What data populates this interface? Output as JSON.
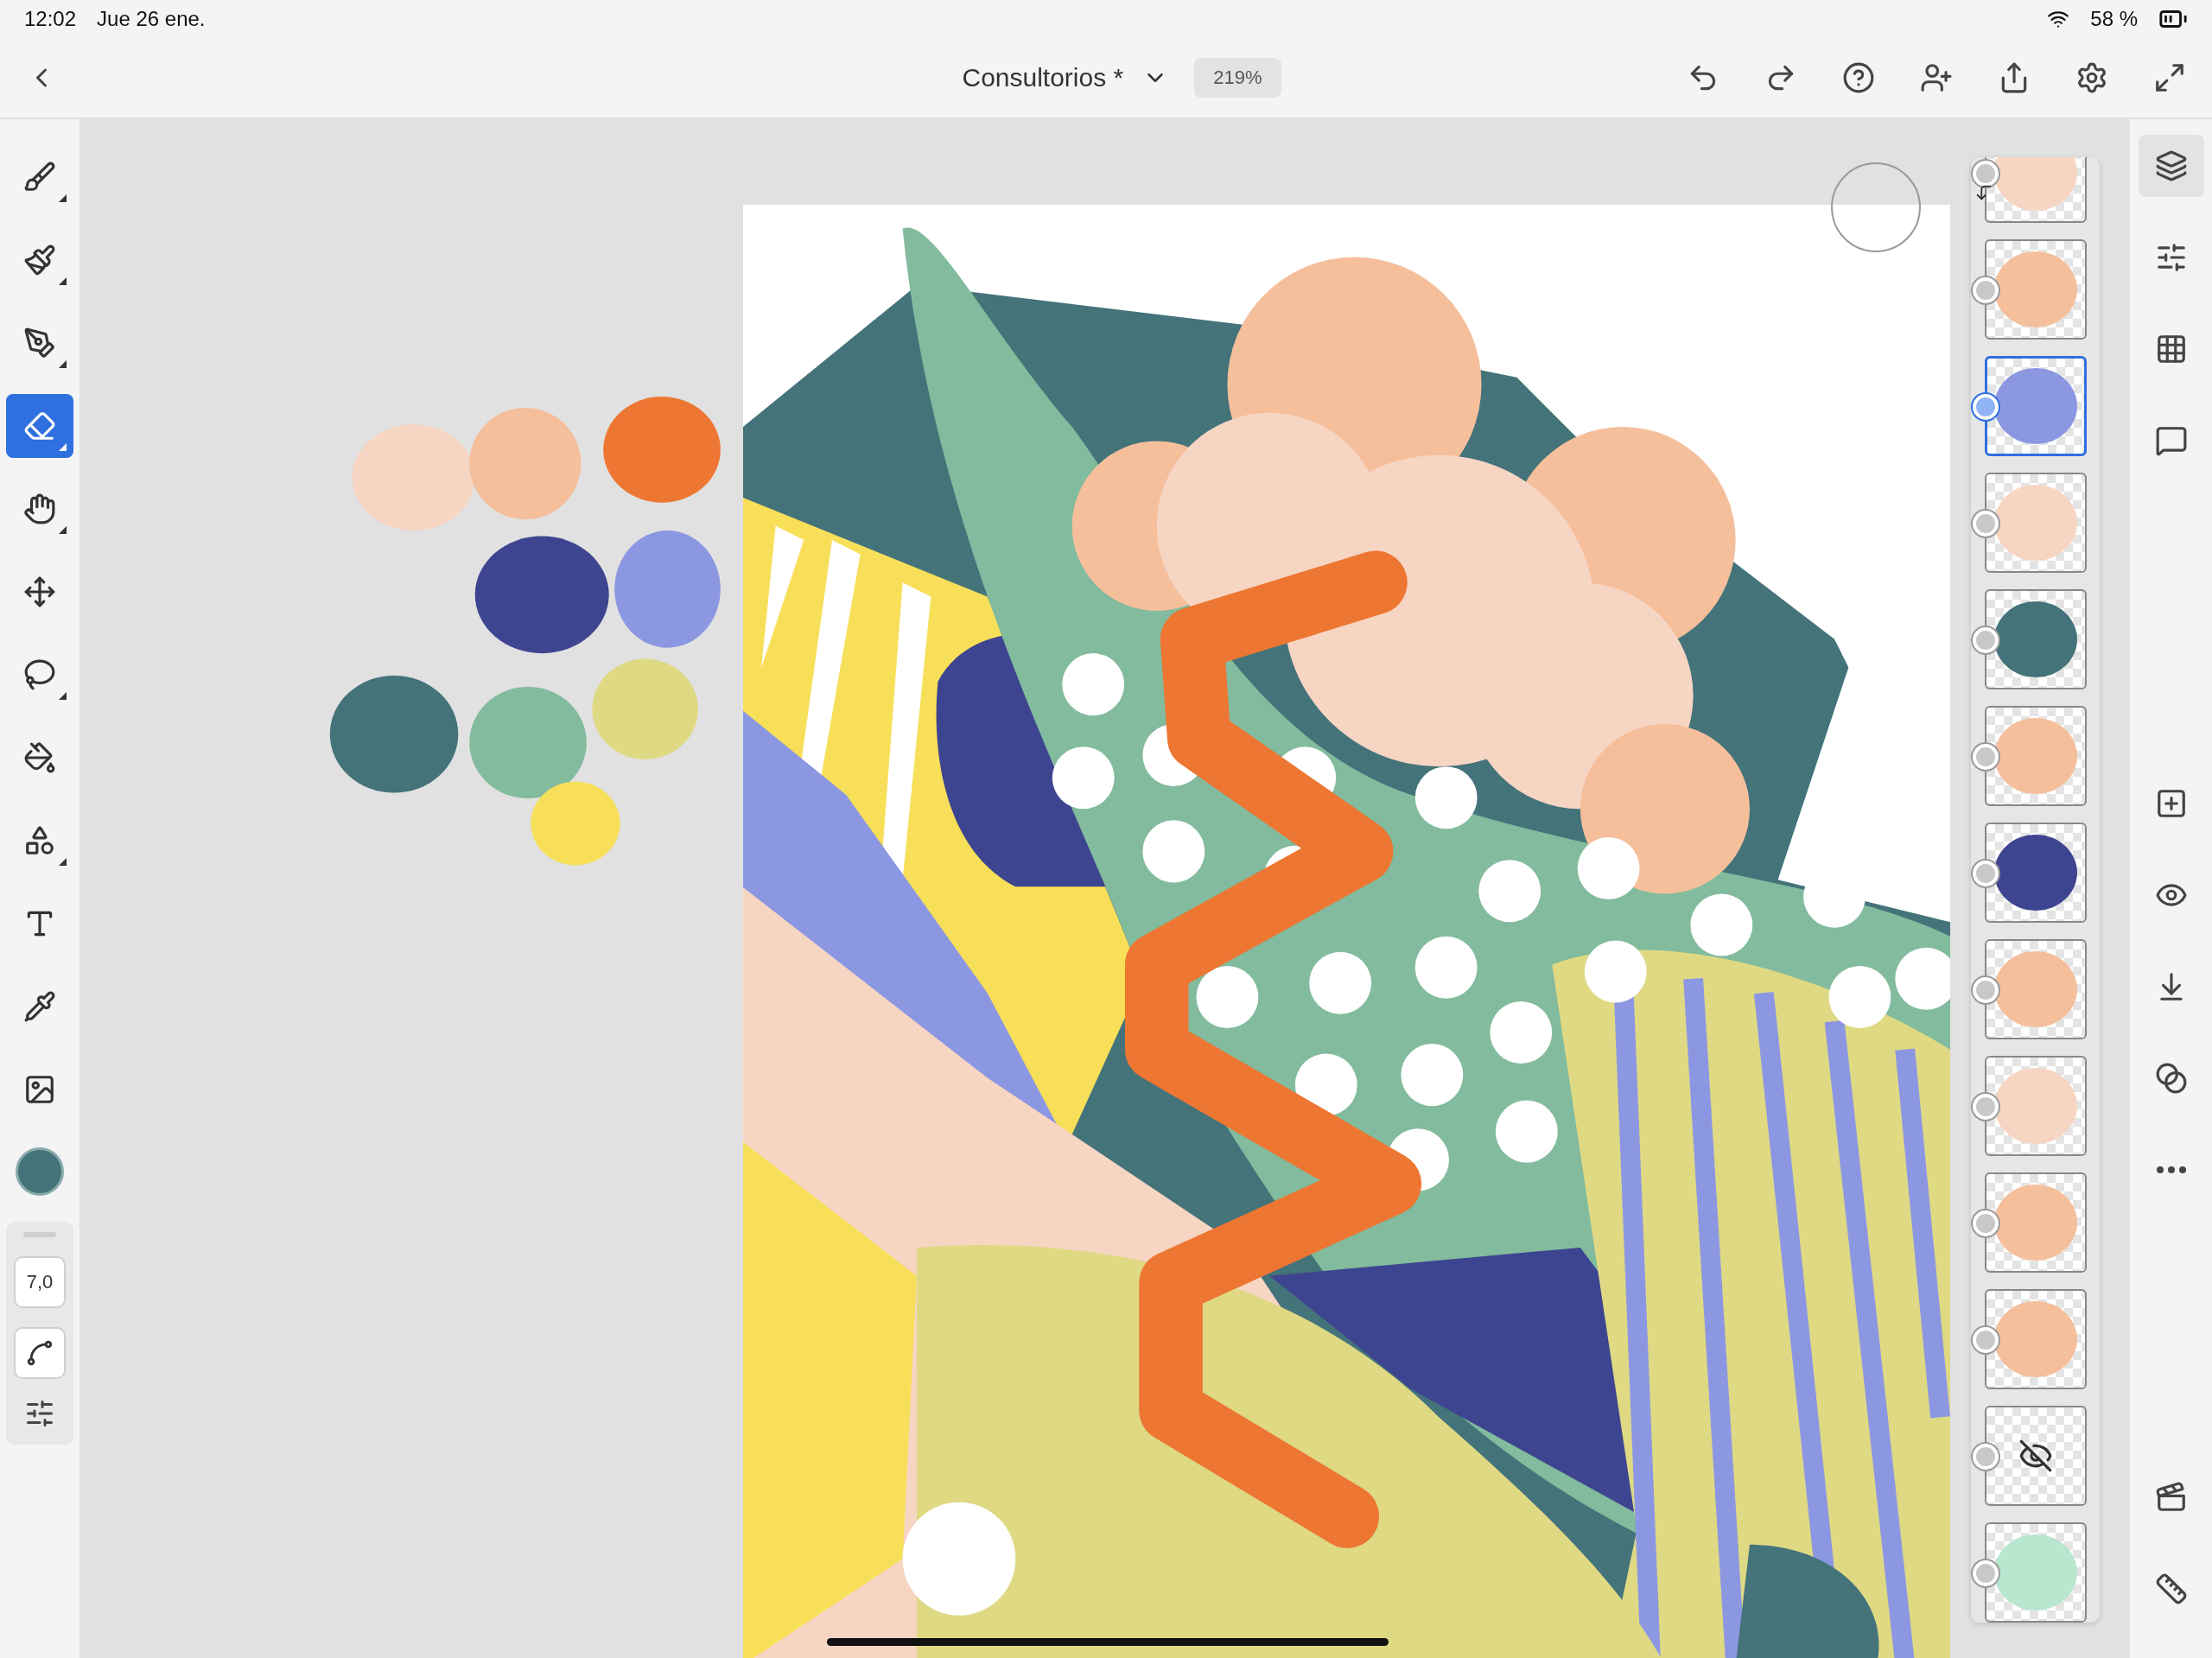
{
  "status_bar": {
    "time": "12:02",
    "date": "Jue 26 ene.",
    "battery": "58 %"
  },
  "document": {
    "title": "Consultorios *",
    "zoom": "219%"
  },
  "tools": [
    {
      "kind": "pixel-brush",
      "selected": false,
      "submenu": true
    },
    {
      "kind": "live-brush",
      "selected": false,
      "submenu": true
    },
    {
      "kind": "vector-brush",
      "selected": false,
      "submenu": true
    },
    {
      "kind": "eraser",
      "selected": true,
      "submenu": true
    },
    {
      "kind": "smudge",
      "selected": false,
      "submenu": true
    },
    {
      "kind": "transform",
      "selected": false,
      "submenu": false
    },
    {
      "kind": "selection",
      "selected": false,
      "submenu": true
    },
    {
      "kind": "fill",
      "selected": false,
      "submenu": false
    },
    {
      "kind": "shapes",
      "selected": false,
      "submenu": true
    },
    {
      "kind": "text",
      "selected": false,
      "submenu": false
    },
    {
      "kind": "eyedropper",
      "selected": false,
      "submenu": false
    },
    {
      "kind": "image",
      "selected": false,
      "submenu": false
    }
  ],
  "current_color": {
    "color": "#44737a"
  },
  "brush": {
    "size": "7,0"
  },
  "palette": [
    {
      "color": "#f7d5c3"
    },
    {
      "color": "#f5bf9c"
    },
    {
      "color": "#ed7632"
    },
    {
      "color": "#3e4590"
    },
    {
      "color": "#8c97e2"
    },
    {
      "color": "#44737a"
    },
    {
      "color": "#82bb9d"
    },
    {
      "color": "#dfd984"
    },
    {
      "color": "#f8df5a"
    }
  ],
  "layers": [
    {
      "selected": false,
      "hidden": false,
      "clipped": true,
      "color": "#f7d5c3"
    },
    {
      "selected": false,
      "hidden": false,
      "clipped": false,
      "color": "#f5bf9c"
    },
    {
      "selected": true,
      "hidden": false,
      "clipped": false,
      "color": "#8c97e2"
    },
    {
      "selected": false,
      "hidden": false,
      "clipped": false,
      "color": "#f7d5c3"
    },
    {
      "selected": false,
      "hidden": false,
      "clipped": false,
      "color": "#44737a"
    },
    {
      "selected": false,
      "hidden": false,
      "clipped": false,
      "color": "#f5bf9c"
    },
    {
      "selected": false,
      "hidden": false,
      "clipped": false,
      "color": "#3e4590"
    },
    {
      "selected": false,
      "hidden": false,
      "clipped": false,
      "color": "#f5bf9c"
    },
    {
      "selected": false,
      "hidden": false,
      "clipped": false,
      "color": "#f7d5c3"
    },
    {
      "selected": false,
      "hidden": false,
      "clipped": false,
      "color": "#f5bf9c"
    },
    {
      "selected": false,
      "hidden": false,
      "clipped": false,
      "color": "#f5bf9c"
    },
    {
      "selected": false,
      "hidden": true,
      "clipped": false
    },
    {
      "selected": false,
      "hidden": false,
      "clipped": false,
      "color": "#b9e6cf"
    }
  ]
}
